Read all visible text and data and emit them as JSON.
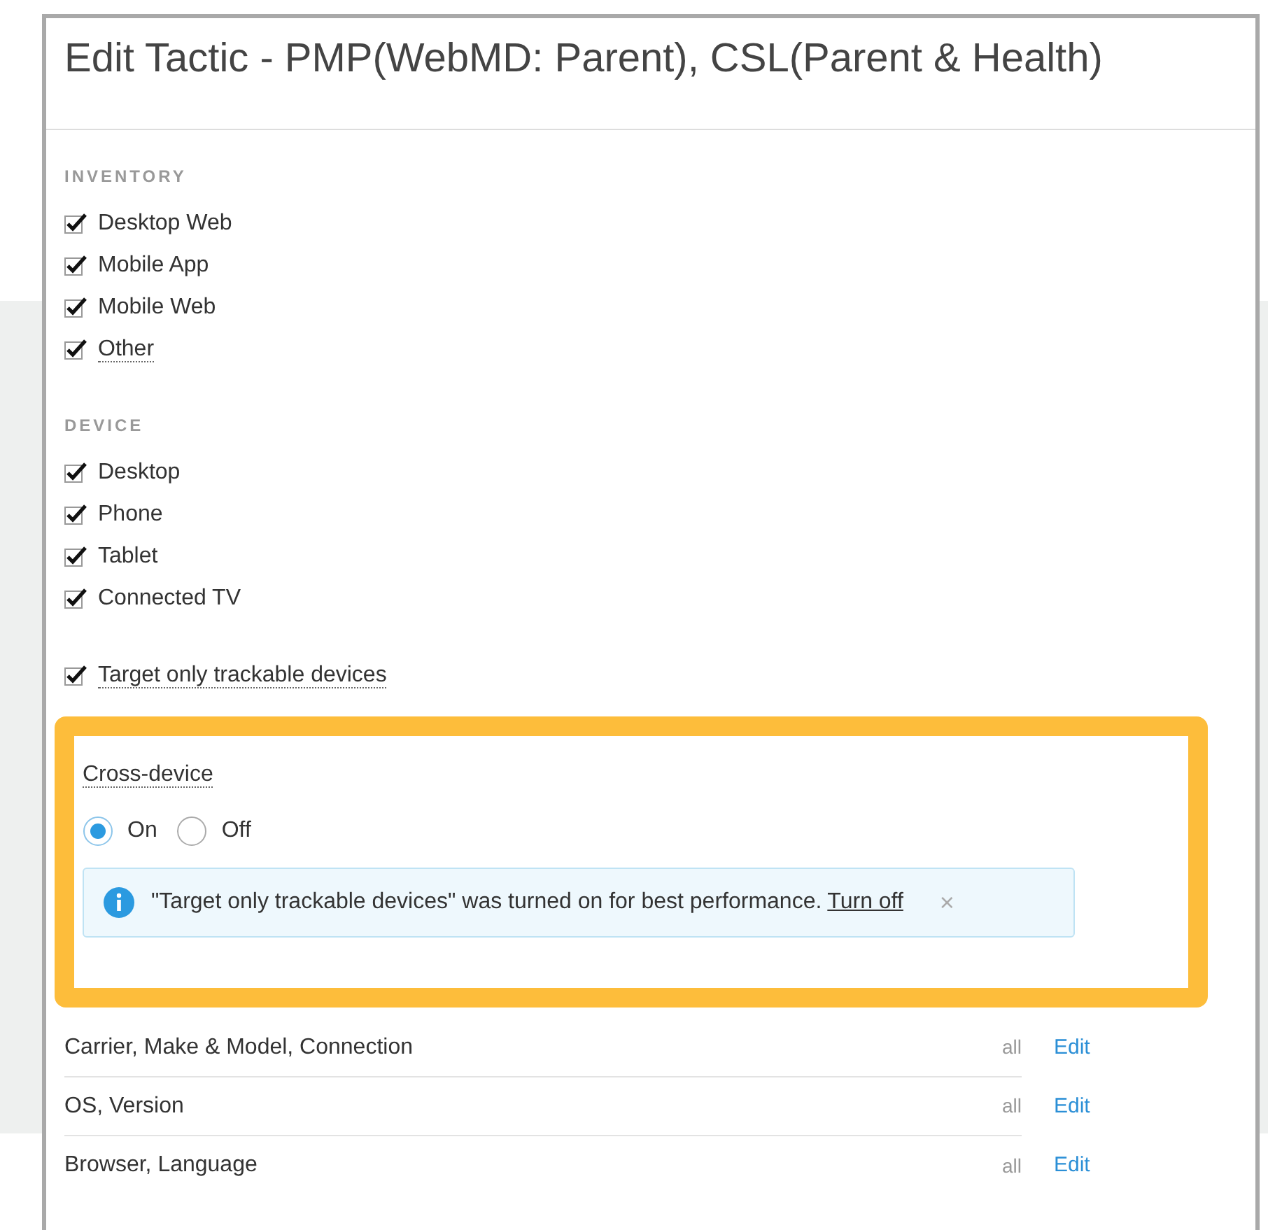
{
  "dialog": {
    "title": "Edit Tactic - PMP(WebMD: Parent), CSL(Parent & Health)"
  },
  "sections": [
    {
      "heading": "INVENTORY",
      "options": [
        {
          "label": "Desktop Web",
          "checked": true,
          "tooltip": false
        },
        {
          "label": "Mobile App",
          "checked": true,
          "tooltip": false
        },
        {
          "label": "Mobile Web",
          "checked": true,
          "tooltip": false
        },
        {
          "label": "Other",
          "checked": true,
          "tooltip": true
        }
      ]
    },
    {
      "heading": "DEVICE",
      "options": [
        {
          "label": "Desktop",
          "checked": true,
          "tooltip": false
        },
        {
          "label": "Phone",
          "checked": true,
          "tooltip": false
        },
        {
          "label": "Tablet",
          "checked": true,
          "tooltip": false
        },
        {
          "label": "Connected TV",
          "checked": true,
          "tooltip": false
        }
      ]
    }
  ],
  "trackable": {
    "label": "Target only trackable devices",
    "checked": true,
    "tooltip": true
  },
  "cross_device": {
    "label": "Cross-device",
    "tooltip": true,
    "options": [
      {
        "label": "On",
        "selected": true
      },
      {
        "label": "Off",
        "selected": false
      }
    ],
    "alert": {
      "message": "\"Target only trackable devices\" was turned on for best performance.",
      "link": "Turn off",
      "close": "×"
    }
  },
  "settings": [
    {
      "label": "Carrier, Make & Model, Connection",
      "value": "all",
      "action": "Edit"
    },
    {
      "label": "OS, Version",
      "value": "all",
      "action": "Edit"
    },
    {
      "label": "Browser, Language",
      "value": "all",
      "action": "Edit"
    }
  ]
}
